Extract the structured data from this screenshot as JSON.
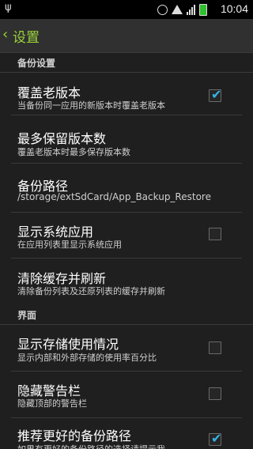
{
  "statusbar": {
    "time": "10:04"
  },
  "actionbar": {
    "title": "设置"
  },
  "sections": {
    "backup": "备份设置",
    "interface": "界面"
  },
  "items": [
    {
      "title": "覆盖老版本",
      "summary": "当备份同一应用的新版本时覆盖老版本",
      "checked": true
    },
    {
      "title": "最多保留版本数",
      "summary": "覆盖老版本时最多保存版本数"
    },
    {
      "title": "备份路径",
      "summary": "/storage/extSdCard/App_Backup_Restore"
    },
    {
      "title": "显示系统应用",
      "summary": "在应用列表里显示系统应用",
      "checked": false
    },
    {
      "title": "清除缓存并刷新",
      "summary": "清除备份列表及还原列表的缓存并刷新"
    },
    {
      "title": "显示存储使用情况",
      "summary": "显示内部和外部存储的使用率百分比",
      "checked": false
    },
    {
      "title": "隐藏警告栏",
      "summary": "隐藏顶部的警告栏",
      "checked": false
    },
    {
      "title": "推荐更好的备份路径",
      "summary": "如果有更好的备份路径的选择请提示我",
      "checked": true
    }
  ],
  "colors": {
    "accent": "#9ad33a",
    "check": "#33b5e5"
  }
}
